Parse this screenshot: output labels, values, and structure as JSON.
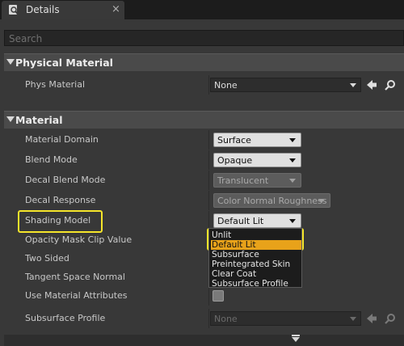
{
  "tab": {
    "title": "Details",
    "icon": "details-magnifier-icon",
    "close": "×"
  },
  "search": {
    "placeholder": "Search"
  },
  "physical_material": {
    "title": "Physical Material",
    "phys_material": {
      "label": "Phys Material",
      "value": "None"
    }
  },
  "material": {
    "title": "Material",
    "rows": {
      "material_domain": {
        "label": "Material Domain",
        "value": "Surface"
      },
      "blend_mode": {
        "label": "Blend Mode",
        "value": "Opaque"
      },
      "decal_blend_mode": {
        "label": "Decal Blend Mode",
        "value": "Translucent"
      },
      "decal_response": {
        "label": "Decal Response",
        "value": "Color Normal Roughness"
      },
      "shading_model": {
        "label": "Shading Model",
        "value": "Default Lit"
      },
      "opacity_mask_clip_value": {
        "label": "Opacity Mask Clip Value"
      },
      "two_sided": {
        "label": "Two Sided"
      },
      "tangent_space_normal": {
        "label": "Tangent Space Normal"
      },
      "use_material_attributes": {
        "label": "Use Material Attributes"
      },
      "subsurface_profile": {
        "label": "Subsurface Profile",
        "value": "None"
      }
    }
  },
  "shading_dropdown": {
    "options": [
      "Unlit",
      "Default Lit",
      "Subsurface",
      "Preintegrated Skin",
      "Clear Coat",
      "Subsurface Profile"
    ],
    "selected": "Default Lit"
  },
  "colors": {
    "highlight": "#f5e52a",
    "selection": "#e8a21a"
  }
}
